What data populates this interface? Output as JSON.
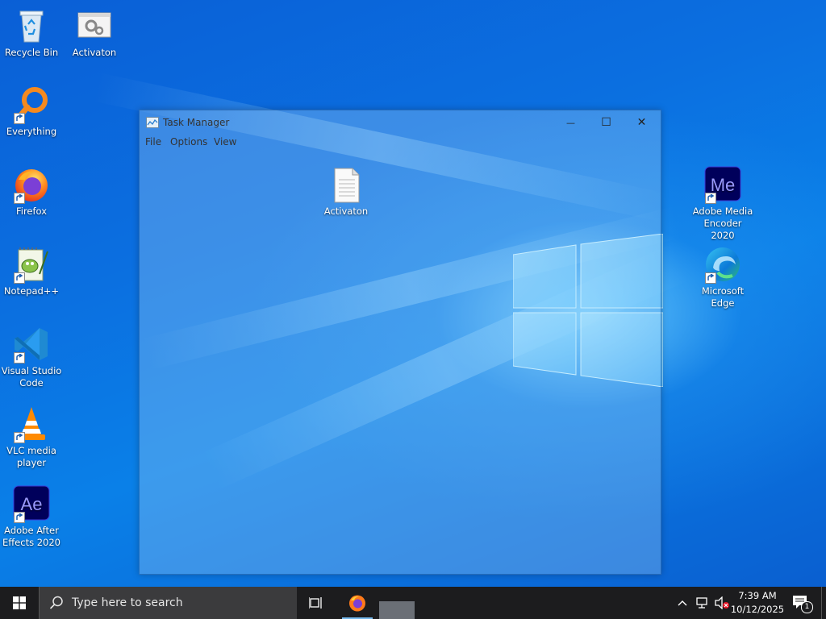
{
  "desktop": {
    "icons_left": [
      {
        "label": "Recycle Bin",
        "icon": "recycle-bin-icon"
      },
      {
        "label": "Activaton",
        "icon": "settings-window-icon"
      },
      {
        "label": "Everything",
        "icon": "magnifier-icon"
      },
      {
        "label": "Firefox",
        "icon": "firefox-icon"
      },
      {
        "label": "Notepad++",
        "icon": "notepadpp-icon"
      },
      {
        "label": "Visual Studio Code",
        "icon": "vscode-icon"
      },
      {
        "label": "VLC media player",
        "icon": "vlc-icon"
      },
      {
        "label": "Adobe After Effects 2020",
        "icon": "after-effects-icon"
      }
    ],
    "icons_right": [
      {
        "label": "Adobe Media Encoder 2020",
        "icon": "media-encoder-icon",
        "glyph": "Me"
      },
      {
        "label": "Microsoft Edge",
        "icon": "edge-icon"
      }
    ],
    "after_effects_glyph": "Ae"
  },
  "task_manager": {
    "title": "Task Manager",
    "menu": [
      "File",
      "Options",
      "View"
    ],
    "minimize_glyph": "—",
    "maximize_glyph": "☐",
    "close_glyph": "✕",
    "file_icon_label": "Activaton"
  },
  "taskbar": {
    "search_placeholder": "Type here to search",
    "time": "7:39 AM",
    "date": "10/12/2025",
    "notification_count": "1",
    "colors": {
      "background": "#1c1c1e",
      "search": "#3b3b3d",
      "accent": "#76b9ed"
    }
  }
}
